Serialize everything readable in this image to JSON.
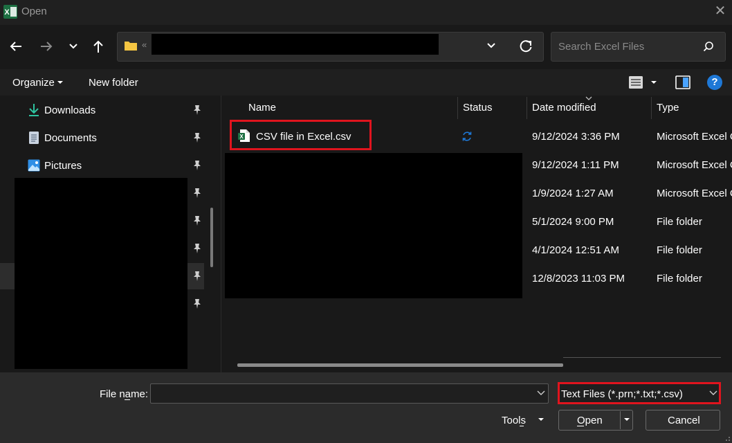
{
  "window": {
    "title": "Open"
  },
  "nav": {
    "search_placeholder": "Search Excel Files",
    "breadcrumb_sep": "«"
  },
  "commandbar": {
    "organize": "Organize",
    "new_folder": "New folder",
    "help": "?"
  },
  "sidebar": {
    "items": [
      {
        "label": "Downloads",
        "icon": "download-icon"
      },
      {
        "label": "Documents",
        "icon": "document-icon"
      },
      {
        "label": "Pictures",
        "icon": "picture-icon"
      }
    ]
  },
  "columns": {
    "name": "Name",
    "status": "Status",
    "date": "Date modified",
    "type": "Type"
  },
  "rows": [
    {
      "name": "CSV file in Excel.csv",
      "date": "9/12/2024 3:36 PM",
      "type": "Microsoft Excel C"
    },
    {
      "name": "",
      "date": "9/12/2024 1:11 PM",
      "type": "Microsoft Excel C"
    },
    {
      "name": "",
      "date": "1/9/2024 1:27 AM",
      "type": "Microsoft Excel C"
    },
    {
      "name": "",
      "date": "5/1/2024 9:00 PM",
      "type": "File folder"
    },
    {
      "name": "",
      "date": "4/1/2024 12:51 AM",
      "type": "File folder"
    },
    {
      "name": "",
      "date": "12/8/2023 11:03 PM",
      "type": "File folder"
    }
  ],
  "footer": {
    "file_name_label": "File name:",
    "file_name_value": "",
    "file_type": "Text Files (*.prn;*.txt;*.csv)",
    "tools": "Tools",
    "open": "Open",
    "cancel": "Cancel"
  },
  "colors": {
    "highlight": "#e0141e",
    "excel_green": "#1d6f42",
    "accent_blue": "#1e78d6"
  }
}
